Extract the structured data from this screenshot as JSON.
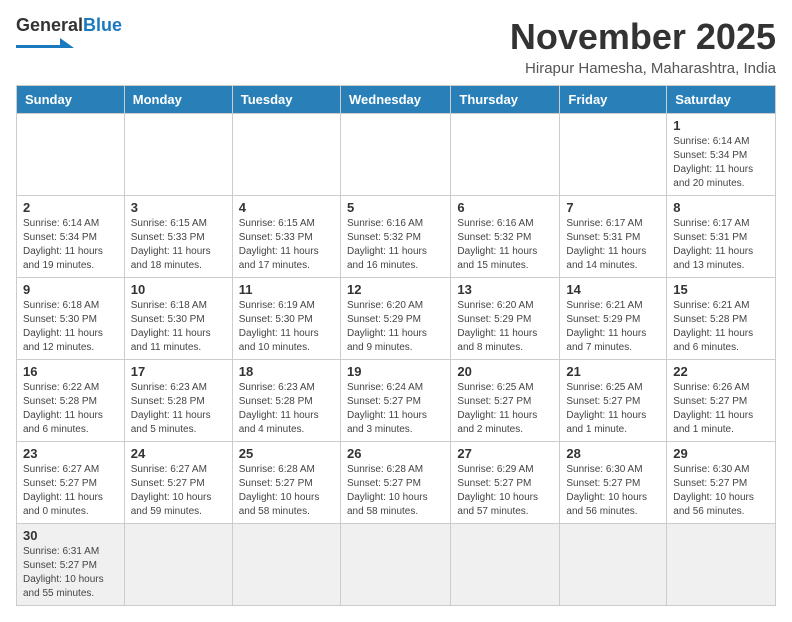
{
  "logo": {
    "text_general": "General",
    "text_blue": "Blue"
  },
  "title": "November 2025",
  "location": "Hirapur Hamesha, Maharashtra, India",
  "weekdays": [
    "Sunday",
    "Monday",
    "Tuesday",
    "Wednesday",
    "Thursday",
    "Friday",
    "Saturday"
  ],
  "weeks": [
    [
      {
        "day": "",
        "info": ""
      },
      {
        "day": "",
        "info": ""
      },
      {
        "day": "",
        "info": ""
      },
      {
        "day": "",
        "info": ""
      },
      {
        "day": "",
        "info": ""
      },
      {
        "day": "",
        "info": ""
      },
      {
        "day": "1",
        "info": "Sunrise: 6:14 AM\nSunset: 5:34 PM\nDaylight: 11 hours\nand 20 minutes."
      }
    ],
    [
      {
        "day": "2",
        "info": "Sunrise: 6:14 AM\nSunset: 5:34 PM\nDaylight: 11 hours\nand 19 minutes."
      },
      {
        "day": "3",
        "info": "Sunrise: 6:15 AM\nSunset: 5:33 PM\nDaylight: 11 hours\nand 18 minutes."
      },
      {
        "day": "4",
        "info": "Sunrise: 6:15 AM\nSunset: 5:33 PM\nDaylight: 11 hours\nand 17 minutes."
      },
      {
        "day": "5",
        "info": "Sunrise: 6:16 AM\nSunset: 5:32 PM\nDaylight: 11 hours\nand 16 minutes."
      },
      {
        "day": "6",
        "info": "Sunrise: 6:16 AM\nSunset: 5:32 PM\nDaylight: 11 hours\nand 15 minutes."
      },
      {
        "day": "7",
        "info": "Sunrise: 6:17 AM\nSunset: 5:31 PM\nDaylight: 11 hours\nand 14 minutes."
      },
      {
        "day": "8",
        "info": "Sunrise: 6:17 AM\nSunset: 5:31 PM\nDaylight: 11 hours\nand 13 minutes."
      }
    ],
    [
      {
        "day": "9",
        "info": "Sunrise: 6:18 AM\nSunset: 5:30 PM\nDaylight: 11 hours\nand 12 minutes."
      },
      {
        "day": "10",
        "info": "Sunrise: 6:18 AM\nSunset: 5:30 PM\nDaylight: 11 hours\nand 11 minutes."
      },
      {
        "day": "11",
        "info": "Sunrise: 6:19 AM\nSunset: 5:30 PM\nDaylight: 11 hours\nand 10 minutes."
      },
      {
        "day": "12",
        "info": "Sunrise: 6:20 AM\nSunset: 5:29 PM\nDaylight: 11 hours\nand 9 minutes."
      },
      {
        "day": "13",
        "info": "Sunrise: 6:20 AM\nSunset: 5:29 PM\nDaylight: 11 hours\nand 8 minutes."
      },
      {
        "day": "14",
        "info": "Sunrise: 6:21 AM\nSunset: 5:29 PM\nDaylight: 11 hours\nand 7 minutes."
      },
      {
        "day": "15",
        "info": "Sunrise: 6:21 AM\nSunset: 5:28 PM\nDaylight: 11 hours\nand 6 minutes."
      }
    ],
    [
      {
        "day": "16",
        "info": "Sunrise: 6:22 AM\nSunset: 5:28 PM\nDaylight: 11 hours\nand 6 minutes."
      },
      {
        "day": "17",
        "info": "Sunrise: 6:23 AM\nSunset: 5:28 PM\nDaylight: 11 hours\nand 5 minutes."
      },
      {
        "day": "18",
        "info": "Sunrise: 6:23 AM\nSunset: 5:28 PM\nDaylight: 11 hours\nand 4 minutes."
      },
      {
        "day": "19",
        "info": "Sunrise: 6:24 AM\nSunset: 5:27 PM\nDaylight: 11 hours\nand 3 minutes."
      },
      {
        "day": "20",
        "info": "Sunrise: 6:25 AM\nSunset: 5:27 PM\nDaylight: 11 hours\nand 2 minutes."
      },
      {
        "day": "21",
        "info": "Sunrise: 6:25 AM\nSunset: 5:27 PM\nDaylight: 11 hours\nand 1 minute."
      },
      {
        "day": "22",
        "info": "Sunrise: 6:26 AM\nSunset: 5:27 PM\nDaylight: 11 hours\nand 1 minute."
      }
    ],
    [
      {
        "day": "23",
        "info": "Sunrise: 6:27 AM\nSunset: 5:27 PM\nDaylight: 11 hours\nand 0 minutes."
      },
      {
        "day": "24",
        "info": "Sunrise: 6:27 AM\nSunset: 5:27 PM\nDaylight: 10 hours\nand 59 minutes."
      },
      {
        "day": "25",
        "info": "Sunrise: 6:28 AM\nSunset: 5:27 PM\nDaylight: 10 hours\nand 58 minutes."
      },
      {
        "day": "26",
        "info": "Sunrise: 6:28 AM\nSunset: 5:27 PM\nDaylight: 10 hours\nand 58 minutes."
      },
      {
        "day": "27",
        "info": "Sunrise: 6:29 AM\nSunset: 5:27 PM\nDaylight: 10 hours\nand 57 minutes."
      },
      {
        "day": "28",
        "info": "Sunrise: 6:30 AM\nSunset: 5:27 PM\nDaylight: 10 hours\nand 56 minutes."
      },
      {
        "day": "29",
        "info": "Sunrise: 6:30 AM\nSunset: 5:27 PM\nDaylight: 10 hours\nand 56 minutes."
      }
    ],
    [
      {
        "day": "30",
        "info": "Sunrise: 6:31 AM\nSunset: 5:27 PM\nDaylight: 10 hours\nand 55 minutes."
      },
      {
        "day": "",
        "info": ""
      },
      {
        "day": "",
        "info": ""
      },
      {
        "day": "",
        "info": ""
      },
      {
        "day": "",
        "info": ""
      },
      {
        "day": "",
        "info": ""
      },
      {
        "day": "",
        "info": ""
      }
    ]
  ]
}
